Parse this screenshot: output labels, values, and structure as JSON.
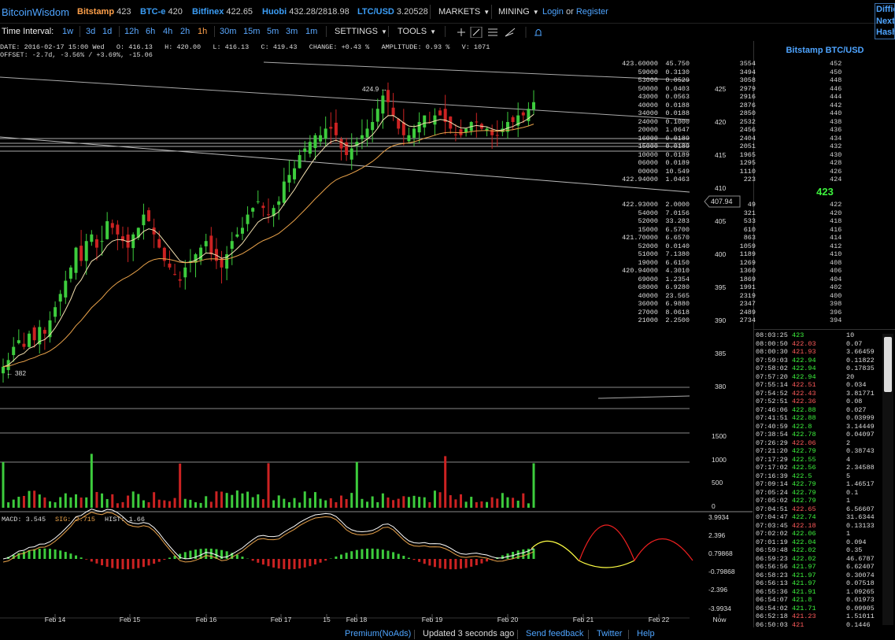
{
  "header": {
    "brand": "BitcoinWisdom",
    "exchanges": [
      {
        "name": "Bitstamp",
        "price": "423",
        "active": true
      },
      {
        "name": "BTC-e",
        "price": "420",
        "active": false
      },
      {
        "name": "Bitfinex",
        "price": "422.65",
        "active": false
      },
      {
        "name": "Huobi",
        "price": "432.28/2818.98",
        "active": false
      },
      {
        "name": "LTC/USD",
        "price": "3.20528",
        "active": false
      }
    ],
    "markets_label": "MARKETS",
    "mining_label": "MINING",
    "login_label": "Login",
    "or_label": "or",
    "register_label": "Register",
    "corner_lines": [
      "Diffic",
      "Next",
      "Hash"
    ]
  },
  "toolbar": {
    "interval_label": "Time Interval:",
    "intervals": [
      "1w",
      "3d",
      "1d",
      "12h",
      "6h",
      "4h",
      "2h",
      "1h",
      "30m",
      "15m",
      "5m",
      "3m",
      "1m"
    ],
    "active_interval": "1h",
    "settings_label": "SETTINGS",
    "tools_label": "TOOLS"
  },
  "info": {
    "line1": "DATE: 2016-02-17 15:00 Wed   O: 416.13   H: 420.00   L: 416.13   C: 419.43   CHANGE: +0.43 %   AMPLITUDE: 0.93 %   V: 1071",
    "line2": "OFFSET: -2.7d, -3.56% / +3.69%, -15.06"
  },
  "chart_data": {
    "type": "candlestick",
    "price_ticks": [
      "425",
      "420",
      "415",
      "410",
      "405",
      "400",
      "395",
      "390",
      "385",
      "380"
    ],
    "volume_ticks": [
      "1500",
      "1000",
      "500",
      "0"
    ],
    "macd_ticks": [
      "3.9934",
      "2.396",
      "0.79868",
      "-0.79868",
      "-2.396",
      "-3.9934"
    ],
    "x_labels": [
      "Feb 14",
      "Feb 15",
      "Feb 16",
      "Feb 17",
      "15",
      "Feb 18",
      "Feb 19",
      "Feb 20",
      "Feb 21",
      "Feb 22",
      "Now"
    ],
    "price_label": "407.94",
    "high_annotation": "424.9 →",
    "low_annotation": "← 382",
    "macd_label": "MACD: 3.545",
    "sig_label": "SIG: 2.715",
    "hist_label": "HIST: 1.66",
    "ylim": [
      378,
      427
    ],
    "close_path": [
      383,
      384,
      386,
      387,
      386,
      388,
      387,
      389,
      388,
      390,
      392,
      394,
      396,
      398,
      401,
      399,
      402,
      403,
      401,
      402,
      405,
      404,
      403,
      402,
      401,
      403,
      404,
      406,
      405,
      403,
      401,
      399,
      398,
      397,
      396,
      398,
      399,
      400,
      401,
      402,
      400,
      399,
      398,
      400,
      402,
      403,
      404,
      406,
      407,
      408,
      407,
      406,
      407,
      408,
      411,
      412,
      413,
      415,
      416,
      417,
      418,
      418,
      419,
      419,
      418,
      416,
      415,
      416,
      417,
      418,
      419,
      420,
      422,
      424,
      423,
      421,
      419,
      418,
      418,
      419,
      420,
      421,
      420,
      421,
      421,
      420,
      419,
      418,
      418,
      419,
      420,
      420,
      419,
      419,
      418,
      418,
      419,
      420,
      420,
      421,
      421,
      422,
      423
    ]
  },
  "sidebar": {
    "title": "Bitstamp BTC/USD",
    "asks": [
      [
        "423.60000",
        "45.750",
        "452",
        "3554"
      ],
      [
        "59000",
        "0.3130",
        "450",
        "3494"
      ],
      [
        "53000",
        "0.0529",
        "448",
        "3058"
      ],
      [
        "50000",
        "0.0403",
        "446",
        "2979"
      ],
      [
        "43000",
        "0.0563",
        "444",
        "2916"
      ],
      [
        "40000",
        "0.0188",
        "442",
        "2876"
      ],
      [
        "34000",
        "0.0188",
        "440",
        "2850"
      ],
      [
        "24000",
        "0.1000",
        "438",
        "2532"
      ],
      [
        "20000",
        "1.0647",
        "436",
        "2456"
      ],
      [
        "16000",
        "0.0189",
        "434",
        "2404"
      ],
      [
        "15000",
        "0.0189",
        "432",
        "2051"
      ],
      [
        "10000",
        "0.0189",
        "430",
        "1965"
      ],
      [
        "06000",
        "0.0189",
        "428",
        "1295"
      ],
      [
        "00000",
        "10.549",
        "426",
        "1110"
      ],
      [
        "422.94000",
        "1.0463",
        "424",
        "223"
      ]
    ],
    "last_price": "423",
    "bids": [
      [
        "422.93000",
        "2.0000",
        "422",
        "49"
      ],
      [
        "54000",
        "7.0156",
        "420",
        "321"
      ],
      [
        "52000",
        "33.283",
        "418",
        "533"
      ],
      [
        "15000",
        "6.5700",
        "416",
        "610"
      ],
      [
        "421.70000",
        "6.6570",
        "414",
        "863"
      ],
      [
        "52000",
        "0.0140",
        "412",
        "1059"
      ],
      [
        "51000",
        "7.1380",
        "410",
        "1189"
      ],
      [
        "19000",
        "6.6150",
        "408",
        "1269"
      ],
      [
        "420.94000",
        "4.3010",
        "406",
        "1360"
      ],
      [
        "69000",
        "1.2354",
        "404",
        "1869"
      ],
      [
        "68000",
        "6.9280",
        "402",
        "1991"
      ],
      [
        "40000",
        "23.565",
        "400",
        "2319"
      ],
      [
        "36000",
        "6.9880",
        "398",
        "2347"
      ],
      [
        "27000",
        "8.0618",
        "396",
        "2489"
      ],
      [
        "21000",
        "2.2500",
        "394",
        "2734"
      ]
    ],
    "trades": [
      [
        "08:03:25",
        "423",
        "10",
        "up"
      ],
      [
        "08:00:50",
        "422.03",
        "0.07",
        "down"
      ],
      [
        "08:00:30",
        "421.93",
        "3.66459",
        "down"
      ],
      [
        "07:59:03",
        "422.94",
        "0.11822",
        "up"
      ],
      [
        "07:58:02",
        "422.94",
        "0.17835",
        "up"
      ],
      [
        "07:57:20",
        "422.94",
        "20",
        "up"
      ],
      [
        "07:55:14",
        "422.51",
        "0.034",
        "down"
      ],
      [
        "07:54:52",
        "422.43",
        "3.81771",
        "down"
      ],
      [
        "07:52:51",
        "422.36",
        "0.08",
        "down"
      ],
      [
        "07:46:06",
        "422.88",
        "0.027",
        "up"
      ],
      [
        "07:41:51",
        "422.88",
        "0.03999",
        "up"
      ],
      [
        "07:40:59",
        "422.8",
        "3.14449",
        "up"
      ],
      [
        "07:38:54",
        "422.78",
        "0.04097",
        "up"
      ],
      [
        "07:26:29",
        "422.06",
        "2",
        "down"
      ],
      [
        "07:21:20",
        "422.79",
        "0.38743",
        "up"
      ],
      [
        "07:17:29",
        "422.55",
        "4",
        "up"
      ],
      [
        "07:17:02",
        "422.56",
        "2.34588",
        "up"
      ],
      [
        "07:16:39",
        "422.5",
        "5",
        "up"
      ],
      [
        "07:09:14",
        "422.79",
        "1.46517",
        "up"
      ],
      [
        "07:05:24",
        "422.79",
        "0.1",
        "up"
      ],
      [
        "07:05:02",
        "422.79",
        "1",
        "up"
      ],
      [
        "07:04:51",
        "422.65",
        "6.56607",
        "down"
      ],
      [
        "07:04:47",
        "422.74",
        "31.6344",
        "up"
      ],
      [
        "07:03:45",
        "422.18",
        "0.13133",
        "down"
      ],
      [
        "07:02:02",
        "422.06",
        "1",
        "up"
      ],
      [
        "07:01:19",
        "422.04",
        "0.094",
        "up"
      ],
      [
        "06:59:48",
        "422.02",
        "0.35",
        "up"
      ],
      [
        "06:59:23",
        "422.02",
        "46.6787",
        "up"
      ],
      [
        "06:56:56",
        "421.97",
        "6.62407",
        "up"
      ],
      [
        "06:58:23",
        "421.97",
        "0.30074",
        "up"
      ],
      [
        "06:56:13",
        "421.97",
        "0.07518",
        "up"
      ],
      [
        "06:55:36",
        "421.91",
        "1.09265",
        "up"
      ],
      [
        "06:54:07",
        "421.8",
        "0.01973",
        "up"
      ],
      [
        "06:54:02",
        "421.71",
        "0.09905",
        "up"
      ],
      [
        "06:52:18",
        "421.23",
        "1.51011",
        "down"
      ],
      [
        "06:50:03",
        "421",
        "0.1446",
        "down"
      ]
    ]
  },
  "footer": {
    "premium": "Premium(NoAds)",
    "updated": "Updated 3 seconds ago",
    "feedback": "Send feedback",
    "twitter": "Twitter",
    "help": "Help"
  },
  "colors": {
    "up": "#3dcc3d",
    "down": "#cc2222",
    "link": "#4ea4ff",
    "accent": "#ffa04a",
    "bid": "#3df23d",
    "ask_trade": "#ff5b5b"
  }
}
